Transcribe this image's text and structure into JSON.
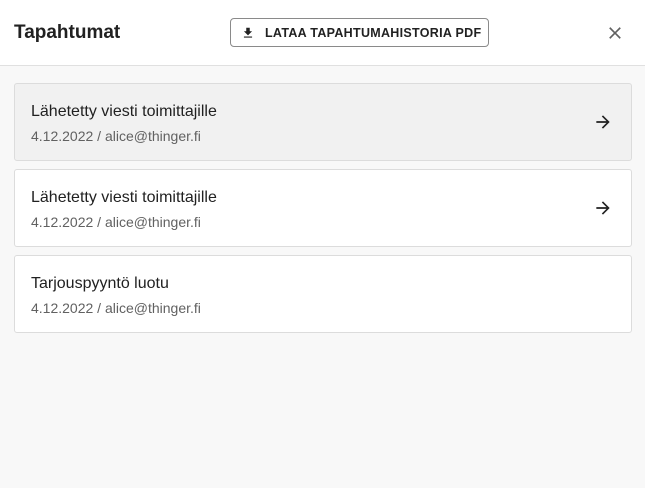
{
  "header": {
    "title": "Tapahtumat",
    "download_label": "LATAA TAPAHTUMAHISTORIA PDF",
    "download_icon": "download-icon",
    "close_icon": "close-icon"
  },
  "events": [
    {
      "title": "Lähetetty viesti toimittajille",
      "meta": "4.12.2022 / alice@thinger.fi",
      "has_arrow": true,
      "arrow_icon": "arrow-right-icon",
      "hovered": true
    },
    {
      "title": "Lähetetty viesti toimittajille",
      "meta": "4.12.2022 / alice@thinger.fi",
      "has_arrow": true,
      "arrow_icon": "arrow-right-icon",
      "hovered": false
    },
    {
      "title": "Tarjouspyyntö luotu",
      "meta": "4.12.2022 / alice@thinger.fi",
      "has_arrow": false,
      "hovered": false
    }
  ],
  "colors": {
    "background": "#f8f8f8",
    "card_background": "#ffffff",
    "card_hover_background": "#f1f1f1",
    "text_primary": "#212121",
    "text_secondary": "#616161"
  }
}
